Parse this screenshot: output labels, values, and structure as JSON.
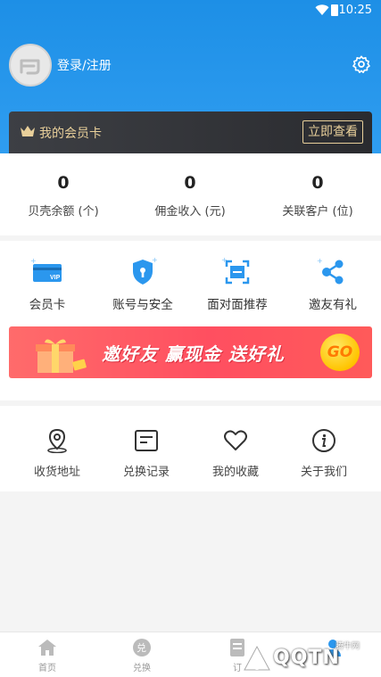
{
  "status_bar": {
    "time": "10:25"
  },
  "profile": {
    "login_label": "登录/注册"
  },
  "vip_card": {
    "label": "我的会员卡",
    "button": "立即查看"
  },
  "stats": [
    {
      "value": "0",
      "label": "贝壳余额 (个)"
    },
    {
      "value": "0",
      "label": "佣金收入 (元)"
    },
    {
      "value": "0",
      "label": "关联客户 (位)"
    }
  ],
  "features": [
    {
      "label": "会员卡",
      "icon": "vip-card-icon"
    },
    {
      "label": "账号与安全",
      "icon": "shield-icon"
    },
    {
      "label": "面对面推荐",
      "icon": "scan-icon"
    },
    {
      "label": "邀友有礼",
      "icon": "share-icon"
    }
  ],
  "banner": {
    "text": "邀好友  赢现金  送好礼",
    "go": "GO"
  },
  "services": [
    {
      "label": "收货地址",
      "icon": "location-icon"
    },
    {
      "label": "兑换记录",
      "icon": "record-icon"
    },
    {
      "label": "我的收藏",
      "icon": "heart-icon"
    },
    {
      "label": "关于我们",
      "icon": "info-icon"
    }
  ],
  "tabbar": [
    {
      "label": "首页",
      "icon": "home-icon"
    },
    {
      "label": "兑换",
      "icon": "exchange-icon"
    },
    {
      "label": "订",
      "icon": "order-icon"
    },
    {
      "label": "",
      "icon": "profile-icon"
    }
  ],
  "watermark": {
    "text": "QQTN",
    "small": "腾牛网"
  },
  "colors": {
    "primary": "#2b97ee",
    "gold": "#e8cf9a",
    "banner": "#ff5060"
  }
}
